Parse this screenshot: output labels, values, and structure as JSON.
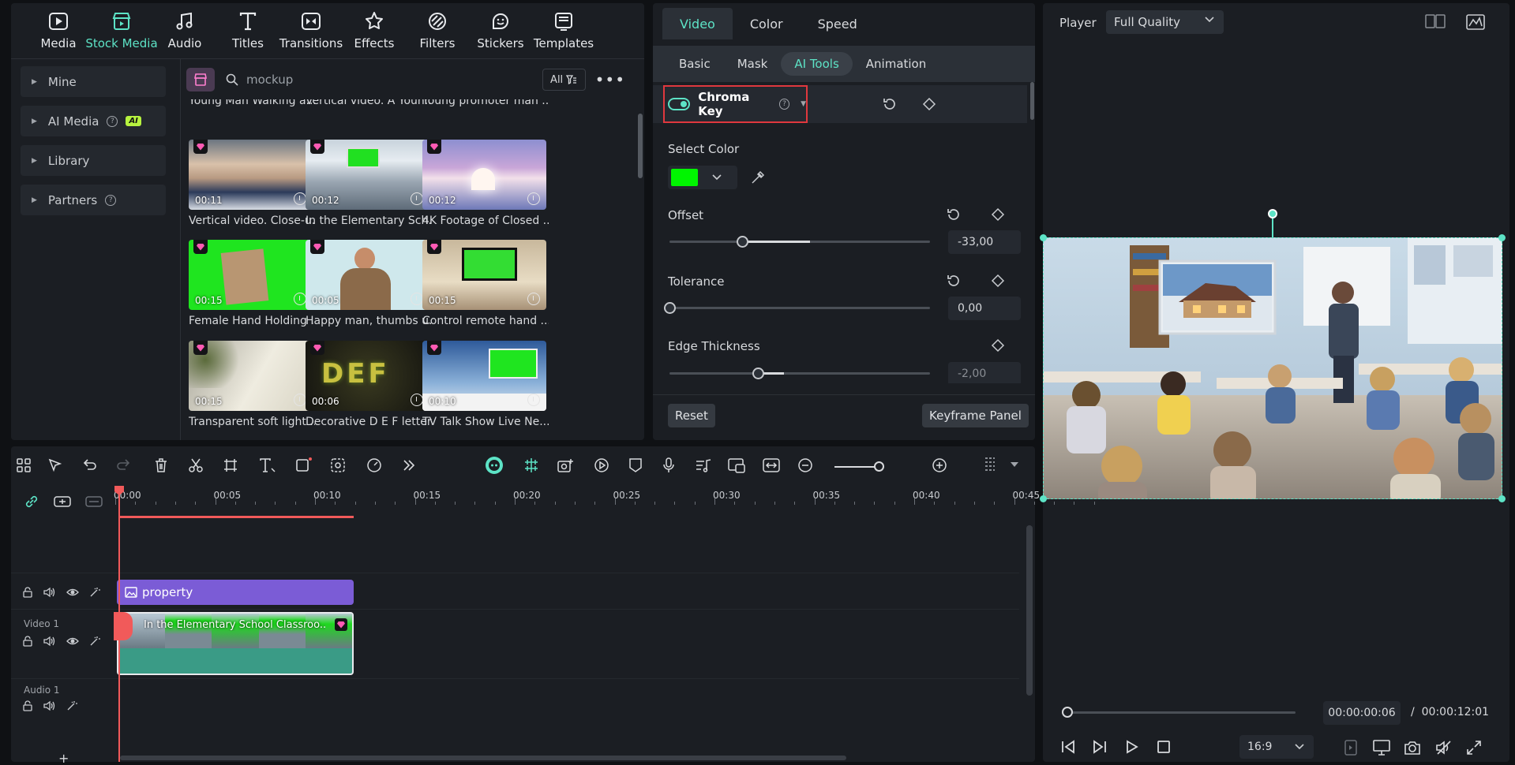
{
  "media_panel": {
    "nav": [
      {
        "label": "Media",
        "icon": "media-icon",
        "active": false
      },
      {
        "label": "Stock Media",
        "icon": "stock-media-icon",
        "active": true
      },
      {
        "label": "Audio",
        "icon": "music-note-icon",
        "active": false
      },
      {
        "label": "Titles",
        "icon": "titles-icon",
        "active": false
      },
      {
        "label": "Transitions",
        "icon": "transitions-icon",
        "active": false
      },
      {
        "label": "Effects",
        "icon": "effects-icon",
        "active": false
      },
      {
        "label": "Filters",
        "icon": "filters-icon",
        "active": false
      },
      {
        "label": "Stickers",
        "icon": "stickers-icon",
        "active": false
      },
      {
        "label": "Templates",
        "icon": "templates-icon",
        "active": false
      }
    ],
    "sidebar": [
      {
        "label": "Mine"
      },
      {
        "label": "AI Media",
        "badge": "AI"
      },
      {
        "label": "Library"
      },
      {
        "label": "Partners"
      }
    ],
    "search": {
      "value": "mockup",
      "filter_label": "All"
    },
    "items": [
      {
        "title": "Young Man Walking a...",
        "duration": "",
        "premium": false
      },
      {
        "title": "Vertical video. A Youn...",
        "duration": "",
        "premium": false
      },
      {
        "title": "Young promoter man ...",
        "duration": "",
        "premium": false
      },
      {
        "title": "Vertical video. Close-u...",
        "duration": "00:11",
        "premium": true
      },
      {
        "title": "In the Elementary Sch...",
        "duration": "00:12",
        "premium": true
      },
      {
        "title": "4K Footage of Closed ...",
        "duration": "00:12",
        "premium": true
      },
      {
        "title": "Female Hand Holding ...",
        "duration": "00:15",
        "premium": true
      },
      {
        "title": "Happy man, thumbs u...",
        "duration": "00:05",
        "premium": true
      },
      {
        "title": "Control remote hand ...",
        "duration": "00:15",
        "premium": true
      },
      {
        "title": "Transparent soft light ...",
        "duration": "00:15",
        "premium": true
      },
      {
        "title": "Decorative D E F letter...",
        "duration": "00:06",
        "premium": true
      },
      {
        "title": "TV Talk Show Live Ne...",
        "duration": "00:10",
        "premium": true
      }
    ]
  },
  "props": {
    "tabs": [
      "Video",
      "Color",
      "Speed"
    ],
    "active_tab": "Video",
    "subtabs": [
      "Basic",
      "Mask",
      "AI Tools",
      "Animation"
    ],
    "active_subtab": "AI Tools",
    "chroma_key": {
      "label": "Chroma Key",
      "enabled": true
    },
    "select_color": {
      "label": "Select Color",
      "value": "#00f500"
    },
    "offset": {
      "label": "Offset",
      "value": "-33,00",
      "level": -0.33
    },
    "tolerance": {
      "label": "Tolerance",
      "value": "0,00",
      "level": 0
    },
    "edge_thickness": {
      "label": "Edge Thickness",
      "value": "-2,00",
      "level": -0.02
    },
    "reset_label": "Reset",
    "keyframe_label": "Keyframe Panel"
  },
  "player": {
    "label": "Player",
    "quality": "Full Quality",
    "current_time": "00:00:00:06",
    "separator": "/",
    "total_time": "00:00:12:01",
    "aspect_ratio": "16:9"
  },
  "timeline": {
    "ruler": [
      "00:00",
      "00:05",
      "00:10",
      "00:15",
      "00:20",
      "00:25",
      "00:30",
      "00:35",
      "00:40",
      "00:45"
    ],
    "tracks": {
      "video": "Video 1",
      "audio": "Audio 1"
    },
    "clips": {
      "image": "property",
      "video": "In the Elementary School Classroo..."
    },
    "add_track": "+"
  },
  "colors": {
    "accent": "#5de3c6",
    "selection_red": "#e0383e",
    "playhead": "#f15a5a",
    "image_clip": "#7b5cd6",
    "video_clip": "#3a9b86",
    "key_color": "#00f500"
  }
}
